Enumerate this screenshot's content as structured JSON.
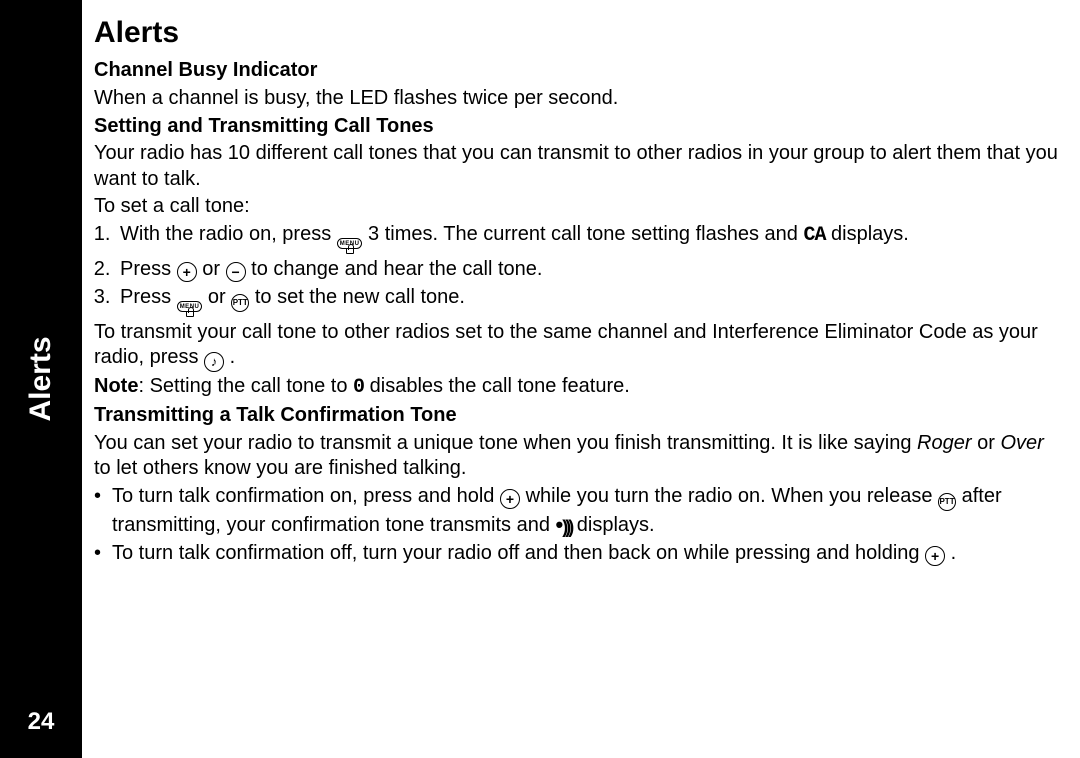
{
  "sidebar": {
    "label": "Alerts",
    "page_number": "24"
  },
  "title": "Alerts",
  "sections": {
    "busy": {
      "heading": "Channel Busy Indicator",
      "body": "When a channel is busy, the LED flashes twice per second."
    },
    "calltones": {
      "heading": "Setting and Transmitting Call Tones",
      "intro": "Your radio has 10 different call tones that you can transmit to other radios in your group to alert them that you want to talk.",
      "toset": "To set a call tone:",
      "step1_a": "With the radio on, press ",
      "step1_b": " 3 times. The current call tone setting flashes and ",
      "step1_sym": "CA",
      "step1_c": " displays.",
      "step2_a": "Press ",
      "step2_mid": " or ",
      "step2_b": " to change and hear the call tone.",
      "step3_a": "Press ",
      "step3_mid": " or ",
      "step3_b": " to set the new call tone.",
      "transmit_a": "To transmit your call tone to other radios set to the same channel and Interference Eliminator Code as your radio, press ",
      "transmit_b": " .",
      "note_label": "Note",
      "note_a": ": Setting the call tone to ",
      "note_sym": "0",
      "note_b": " disables the call tone feature."
    },
    "confirm": {
      "heading": "Transmitting a Talk Confirmation Tone",
      "intro_a": "You can set your radio to transmit a unique tone when you finish transmitting. It is like saying ",
      "roger": "Roger",
      "intro_mid": " or ",
      "over": "Over",
      "intro_b": " to let others know you are finished talking.",
      "b1_a": "To turn talk confirmation on, press and hold ",
      "b1_b": " while you turn the radio on. When you release ",
      "b1_c": " after transmitting, your confirmation tone transmits and ",
      "b1_d": " displays.",
      "b2_a": "To turn talk confirmation off, turn your radio off and then back on while pressing and holding ",
      "b2_b": " ."
    }
  },
  "icons": {
    "plus": "+",
    "minus": "−",
    "menu": "MENU",
    "ptt": "PTT",
    "music": "♪"
  }
}
